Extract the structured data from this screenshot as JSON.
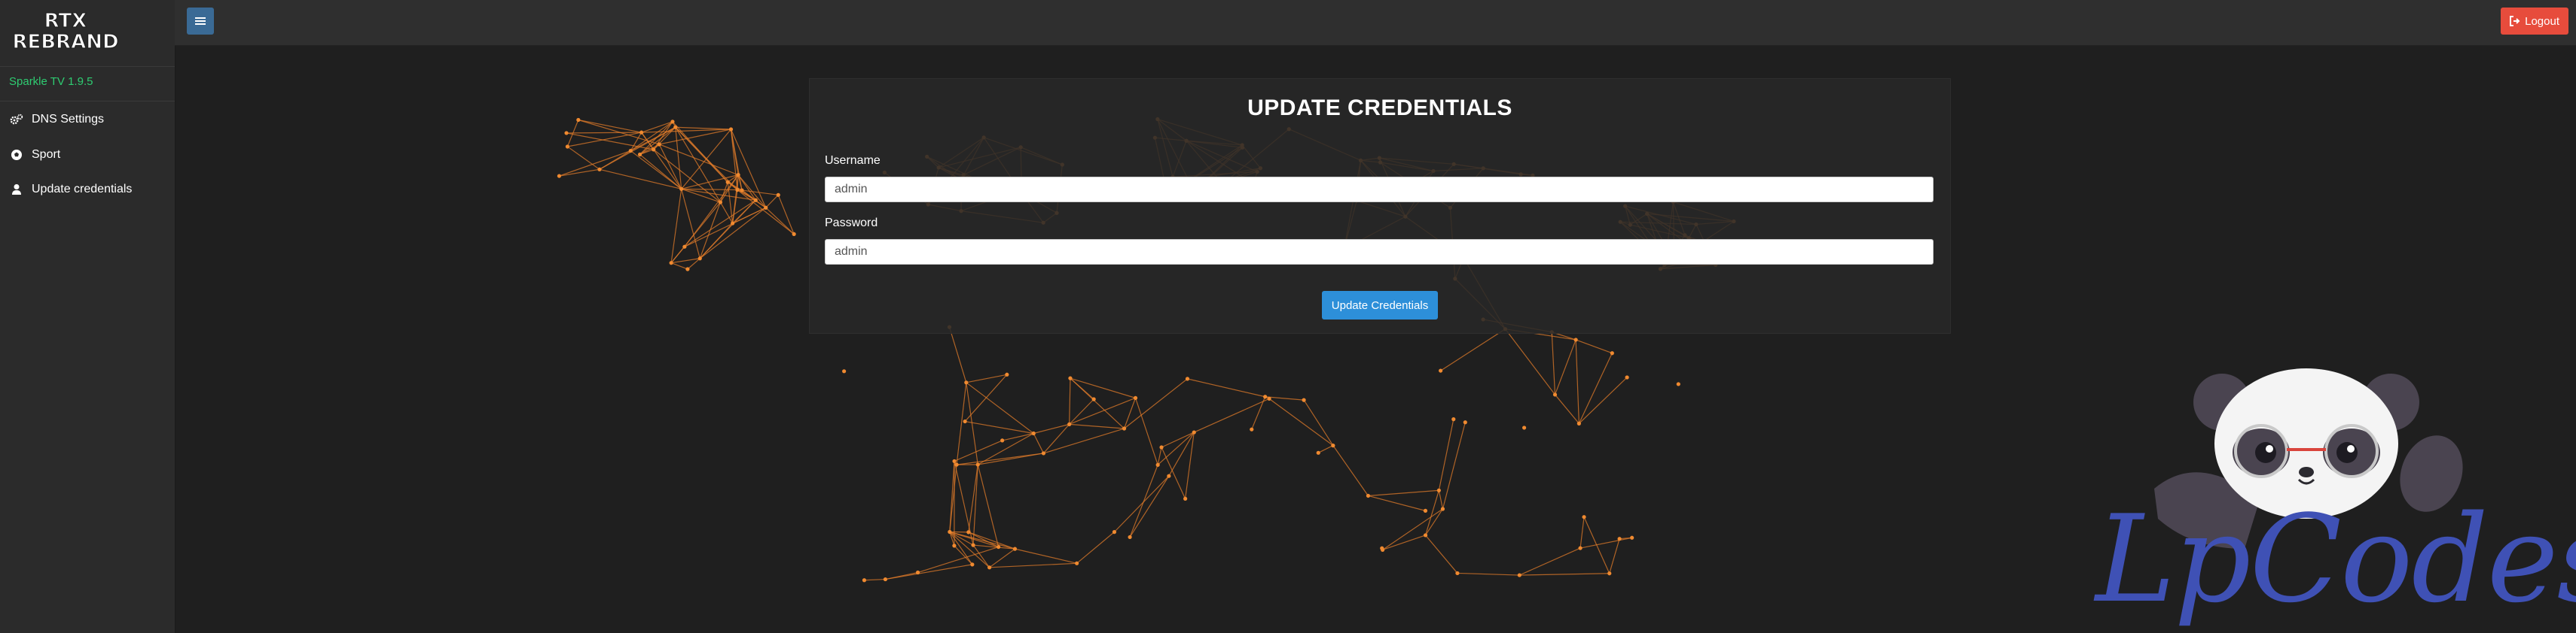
{
  "app": {
    "logo_line1": "RTX",
    "logo_line2": "REBRAND",
    "version": "Sparkle TV 1.9.5"
  },
  "sidebar": {
    "items": [
      {
        "label": "DNS Settings",
        "icon": "cogs-icon"
      },
      {
        "label": "Sport",
        "icon": "soccer-ball-icon"
      },
      {
        "label": "Update credentials",
        "icon": "user-icon"
      }
    ]
  },
  "topbar": {
    "menu_icon": "hamburger-icon",
    "logout_label": "Logout",
    "logout_icon": "sign-out-icon"
  },
  "form": {
    "title": "UPDATE CREDENTIALS",
    "username_label": "Username",
    "username_value": "admin",
    "password_label": "Password",
    "password_value": "admin",
    "submit_label": "Update Credentials"
  },
  "watermark": {
    "text": "LpCodes"
  },
  "colors": {
    "sidebar_bg": "#2b2b2b",
    "topbar_bg": "#2f2f2f",
    "page_bg": "#1f1f1f",
    "version_text": "#2ecc71",
    "menu_button": "#3a6a95",
    "logout_button": "#e74c3c",
    "primary_button": "#2d8fd9",
    "network_lines": "#e07b2a",
    "watermark_text": "#3f51b5"
  }
}
